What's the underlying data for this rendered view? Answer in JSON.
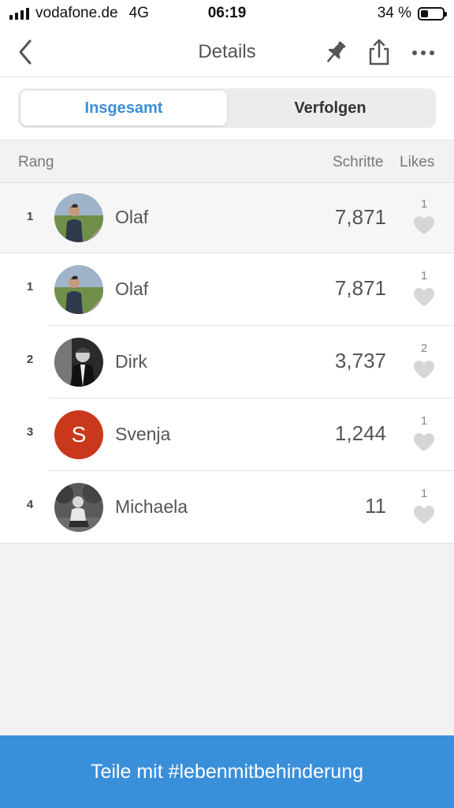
{
  "status_bar": {
    "carrier": "vodafone.de",
    "network": "4G",
    "time": "06:19",
    "battery_percent_text": "34 %",
    "battery_level": 0.34
  },
  "nav": {
    "title": "Details",
    "back_icon": "chevron-left-icon",
    "pin_icon": "pin-icon",
    "share_icon": "share-icon",
    "more_icon": "more-icon"
  },
  "segments": {
    "total": "Insgesamt",
    "following": "Verfolgen",
    "active": "total",
    "accent_color": "#3b8fd6"
  },
  "columns": {
    "rank": "Rang",
    "steps": "Schritte",
    "likes": "Likes"
  },
  "my_entry": {
    "rank": "1",
    "name": "Olaf",
    "steps": "7,871",
    "likes": "1"
  },
  "leaderboard": [
    {
      "rank": "1",
      "name": "Olaf",
      "steps": "7,871",
      "likes": "1",
      "avatar": "photo"
    },
    {
      "rank": "2",
      "name": "Dirk",
      "steps": "3,737",
      "likes": "2",
      "avatar": "photo-bw"
    },
    {
      "rank": "3",
      "name": "Svenja",
      "steps": "1,244",
      "likes": "1",
      "avatar": "S",
      "avatar_color": "#c9381a"
    },
    {
      "rank": "4",
      "name": "Michaela",
      "steps": "11",
      "likes": "1",
      "avatar": "photo-bw"
    }
  ],
  "share_button": {
    "label": "Teile mit #lebenmitbehinderung",
    "color": "#3a8fda"
  }
}
